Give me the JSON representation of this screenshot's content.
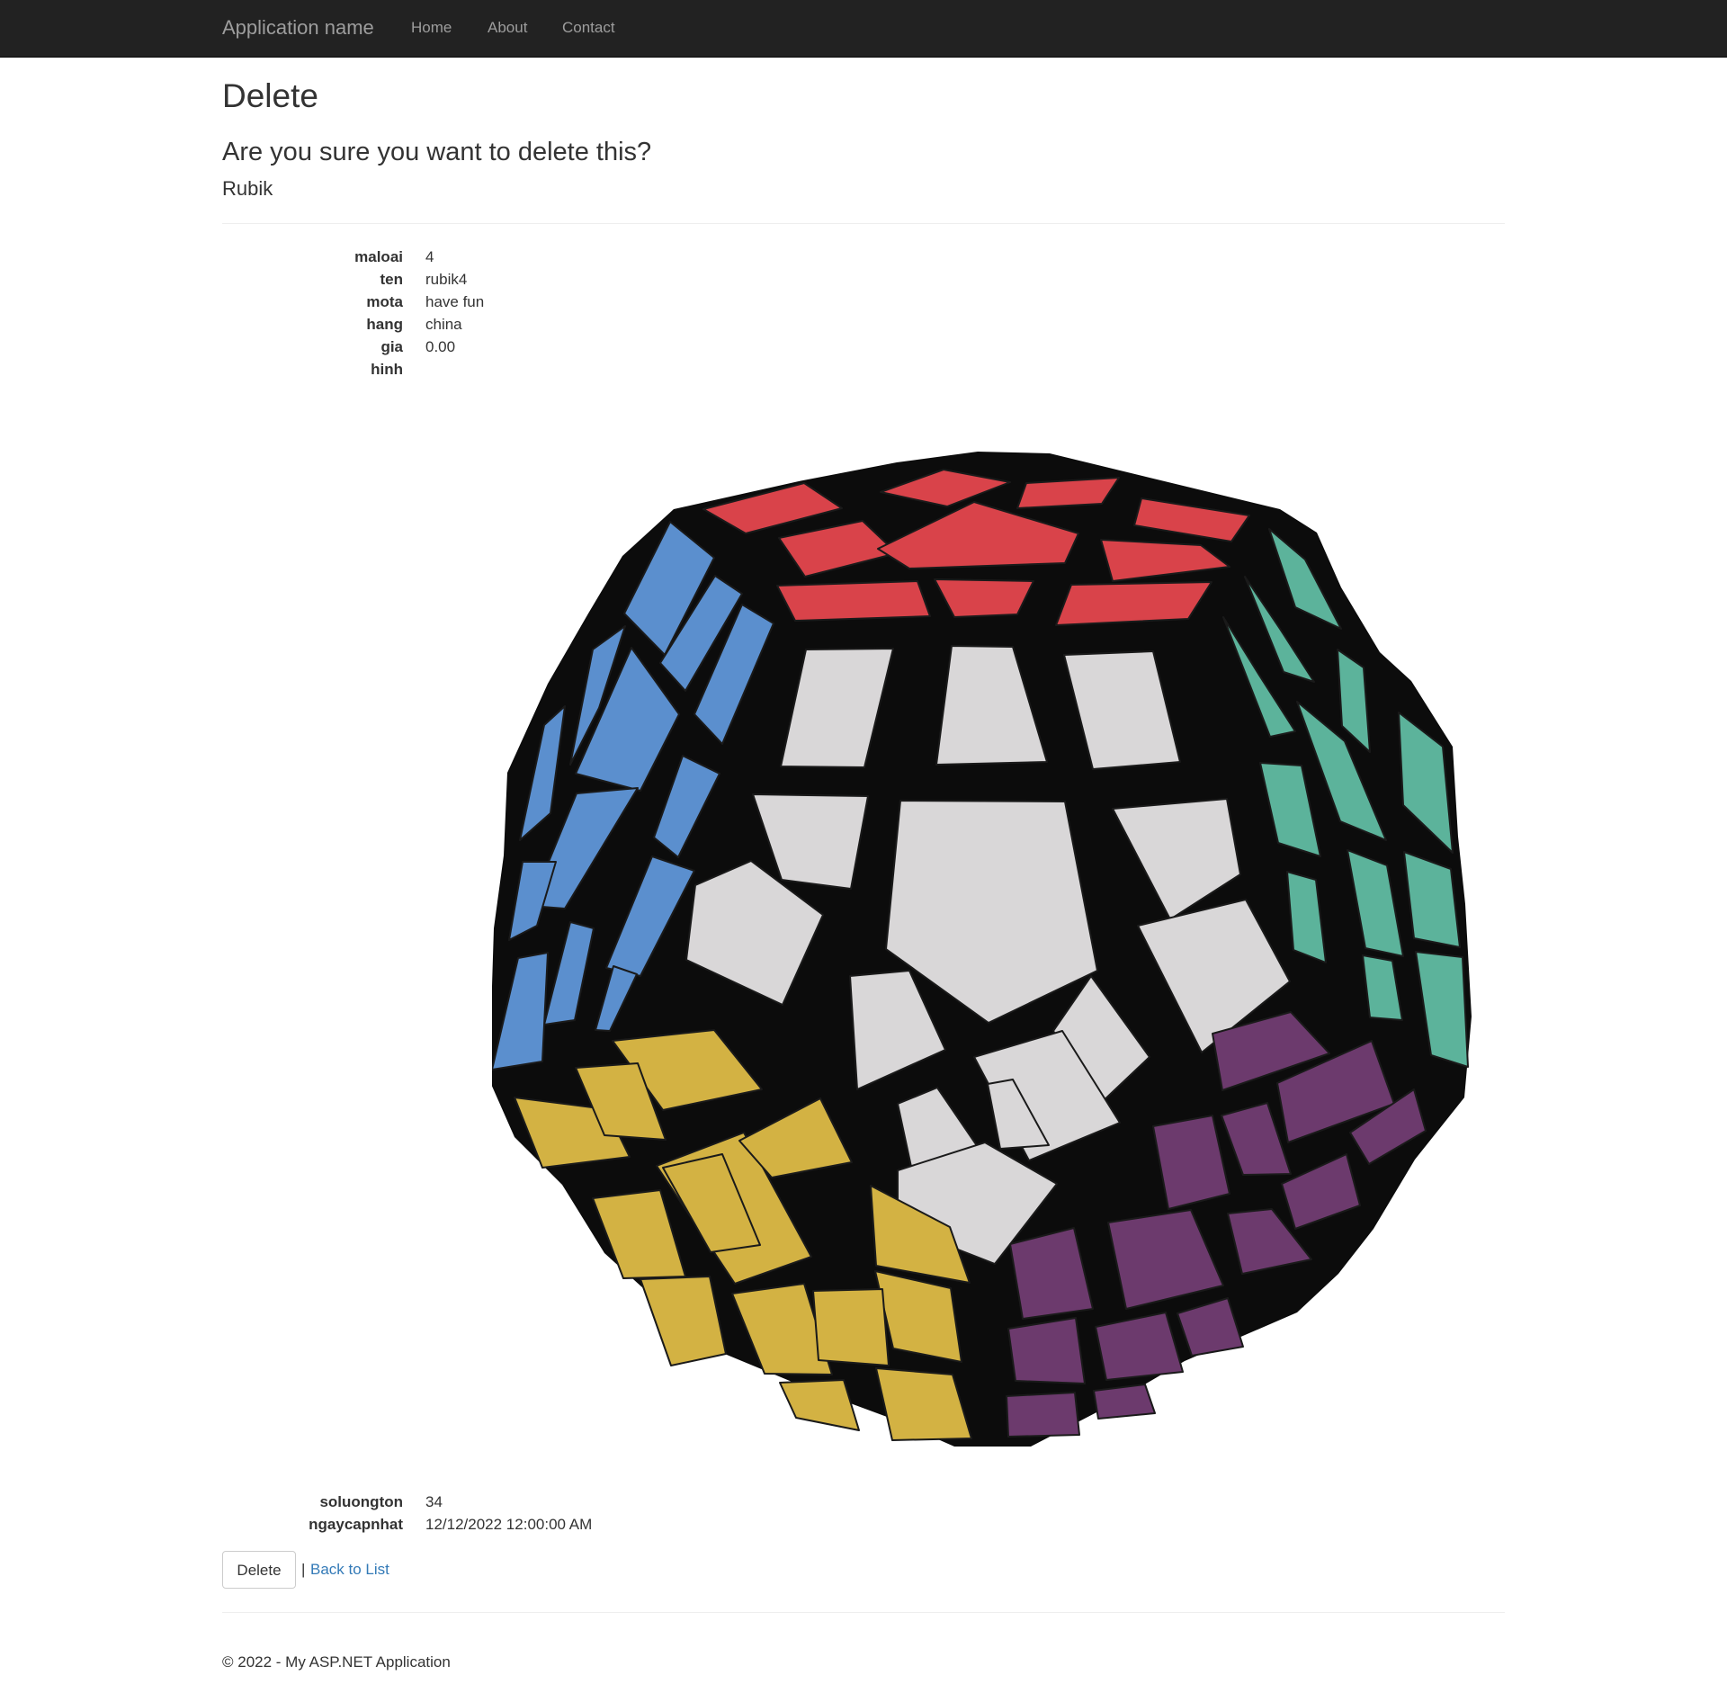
{
  "navbar": {
    "brand": "Application name",
    "links": [
      "Home",
      "About",
      "Contact"
    ]
  },
  "page": {
    "title": "Delete",
    "question": "Are you sure you want to delete this?",
    "entity": "Rubik"
  },
  "details": [
    {
      "label": "maloai",
      "value": "4"
    },
    {
      "label": "ten",
      "value": "rubik4"
    },
    {
      "label": "mota",
      "value": "have fun"
    },
    {
      "label": "hang",
      "value": "china"
    },
    {
      "label": "gia",
      "value": "0.00"
    },
    {
      "label": "hinh",
      "value": ""
    },
    {
      "label": "soluongton",
      "value": "34"
    },
    {
      "label": "ngaycapnhat",
      "value": "12/12/2022 12:00:00 AM"
    }
  ],
  "actions": {
    "delete_label": "Delete",
    "separator": "|",
    "back_label": "Back to List"
  },
  "footer": {
    "text": "© 2022 - My ASP.NET Application"
  },
  "image": {
    "subject": "megaminx-puzzle",
    "colors": {
      "red": "#d9434a",
      "blue": "#5b8fce",
      "teal": "#5cb39b",
      "white": "#d9d7d8",
      "yellow": "#d3b243",
      "purple": "#6c3a6d",
      "body": "#0c0c0c"
    }
  }
}
